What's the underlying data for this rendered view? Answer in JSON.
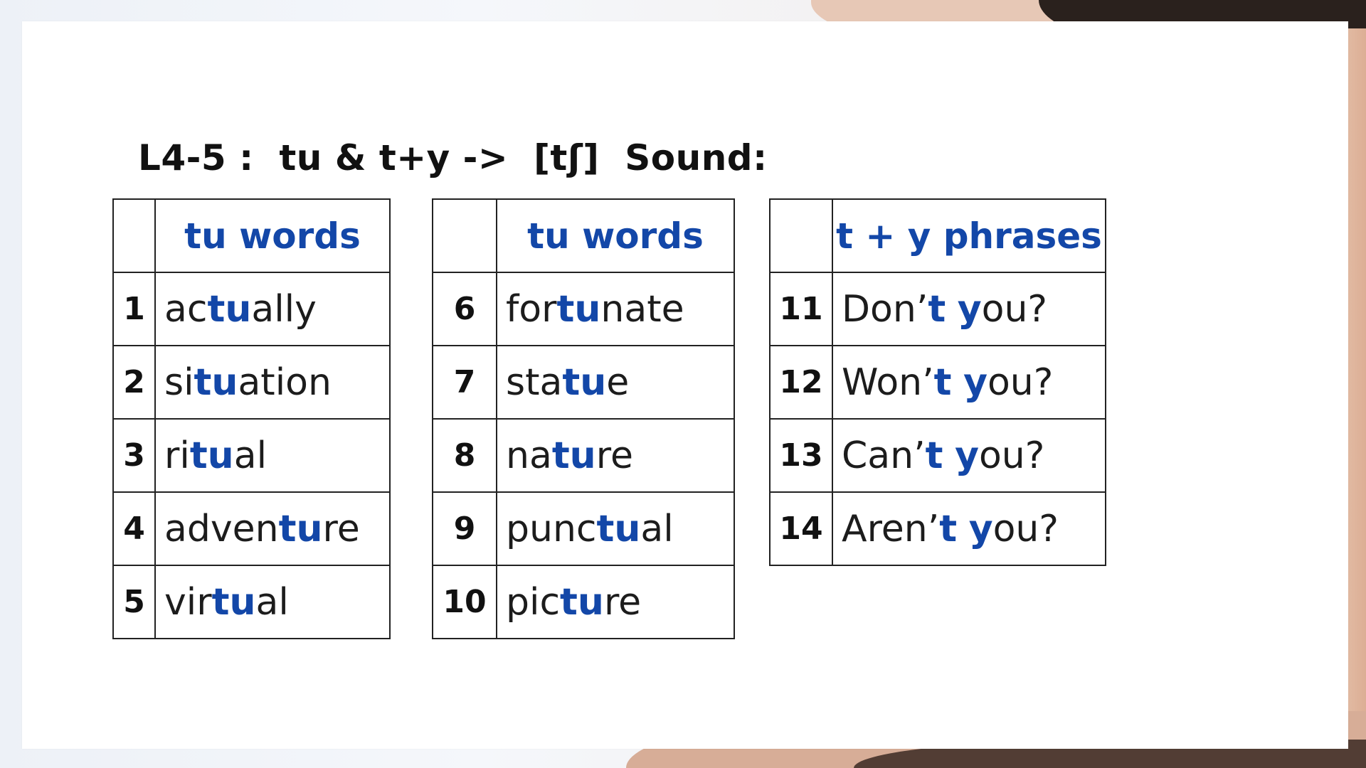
{
  "slide": {
    "title": "L4-5 :  tu & t+y ->  [tʃ]  Sound:"
  },
  "tables": [
    {
      "header": "tu words",
      "rows": [
        {
          "num": "1",
          "pre": "ac",
          "hl": "tu",
          "post": "ally"
        },
        {
          "num": "2",
          "pre": "si",
          "hl": "tu",
          "post": "ation"
        },
        {
          "num": "3",
          "pre": "ri",
          "hl": "tu",
          "post": "al"
        },
        {
          "num": "4",
          "pre": "adven",
          "hl": "tu",
          "post": "re"
        },
        {
          "num": "5",
          "pre": "vir",
          "hl": "tu",
          "post": "al"
        }
      ]
    },
    {
      "header": "tu words",
      "rows": [
        {
          "num": "6",
          "pre": "for",
          "hl": "tu",
          "post": "nate"
        },
        {
          "num": "7",
          "pre": "sta",
          "hl": "tu",
          "post": "e"
        },
        {
          "num": "8",
          "pre": "na",
          "hl": "tu",
          "post": "re"
        },
        {
          "num": "9",
          "pre": "punc",
          "hl": "tu",
          "post": "al"
        },
        {
          "num": "10",
          "pre": "pic",
          "hl": "tu",
          "post": "re"
        }
      ]
    },
    {
      "header": "t + y  phrases",
      "rows": [
        {
          "num": "11",
          "pre": "Don’",
          "hl1": "t",
          "mid": " ",
          "hl2": "y",
          "post": "ou?"
        },
        {
          "num": "12",
          "pre": "Won’",
          "hl1": "t",
          "mid": " ",
          "hl2": "y",
          "post": "ou?"
        },
        {
          "num": "13",
          "pre": "Can’",
          "hl1": "t",
          "mid": " ",
          "hl2": "y",
          "post": "ou?"
        },
        {
          "num": "14",
          "pre": "Aren’",
          "hl1": "t",
          "mid": " ",
          "hl2": "y",
          "post": "ou?"
        }
      ]
    }
  ],
  "colors": {
    "highlight": "#1347a8",
    "text": "#1c1c1c",
    "border": "#222222",
    "slide_background": "#ffffff"
  }
}
